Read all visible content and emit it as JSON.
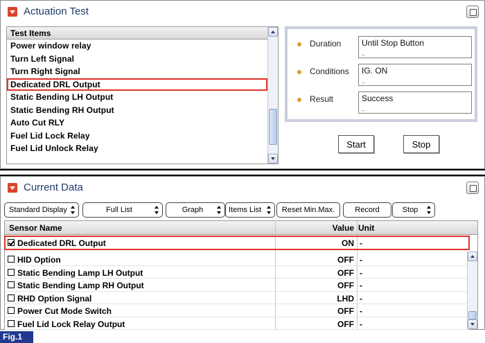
{
  "actuation": {
    "title": "Actuation Test",
    "list_header": "Test Items",
    "items": [
      "Power window relay",
      "Turn Left Signal",
      "Turn Right Signal",
      "Dedicated DRL Output",
      "Static Bending LH Output",
      "Static Bending RH Output",
      "Auto Cut RLY",
      "Fuel Lid Lock Relay",
      "Fuel Lid Unlock Relay"
    ],
    "selected_index": 3,
    "info": {
      "duration_label": "Duration",
      "duration_value": "Until Stop Button",
      "conditions_label": "Conditions",
      "conditions_value": "IG. ON",
      "result_label": "Result",
      "result_value": "Success"
    },
    "start_label": "Start",
    "stop_label": "Stop"
  },
  "current": {
    "title": "Current Data",
    "toolbar": {
      "display": "Standard Display",
      "list": "Full List",
      "graph": "Graph",
      "items_list": "Items List",
      "reset": "Reset Min.Max.",
      "record": "Record",
      "stop": "Stop"
    },
    "headers": {
      "name": "Sensor Name",
      "value": "Value",
      "unit": "Unit"
    },
    "rows": [
      {
        "name": "Dedicated DRL Output",
        "value": "ON",
        "unit": "-",
        "checked": true
      },
      {
        "name": "HID Option",
        "value": "OFF",
        "unit": "-",
        "checked": false
      },
      {
        "name": "Static Bending Lamp LH Output",
        "value": "OFF",
        "unit": "-",
        "checked": false
      },
      {
        "name": "Static Bending Lamp RH Output",
        "value": "OFF",
        "unit": "-",
        "checked": false
      },
      {
        "name": "RHD Option Signal",
        "value": "LHD",
        "unit": "-",
        "checked": false
      },
      {
        "name": "Power Cut Mode Switch",
        "value": "OFF",
        "unit": "-",
        "checked": false
      },
      {
        "name": "Fuel Lid Lock Relay Output",
        "value": "OFF",
        "unit": "-",
        "checked": false
      }
    ]
  },
  "figure_label": "Fig.1",
  "colors": {
    "accent": "#d9452b",
    "title": "#1f3a6e",
    "highlight": "#e0342a",
    "figure": "#1f3a8f"
  }
}
